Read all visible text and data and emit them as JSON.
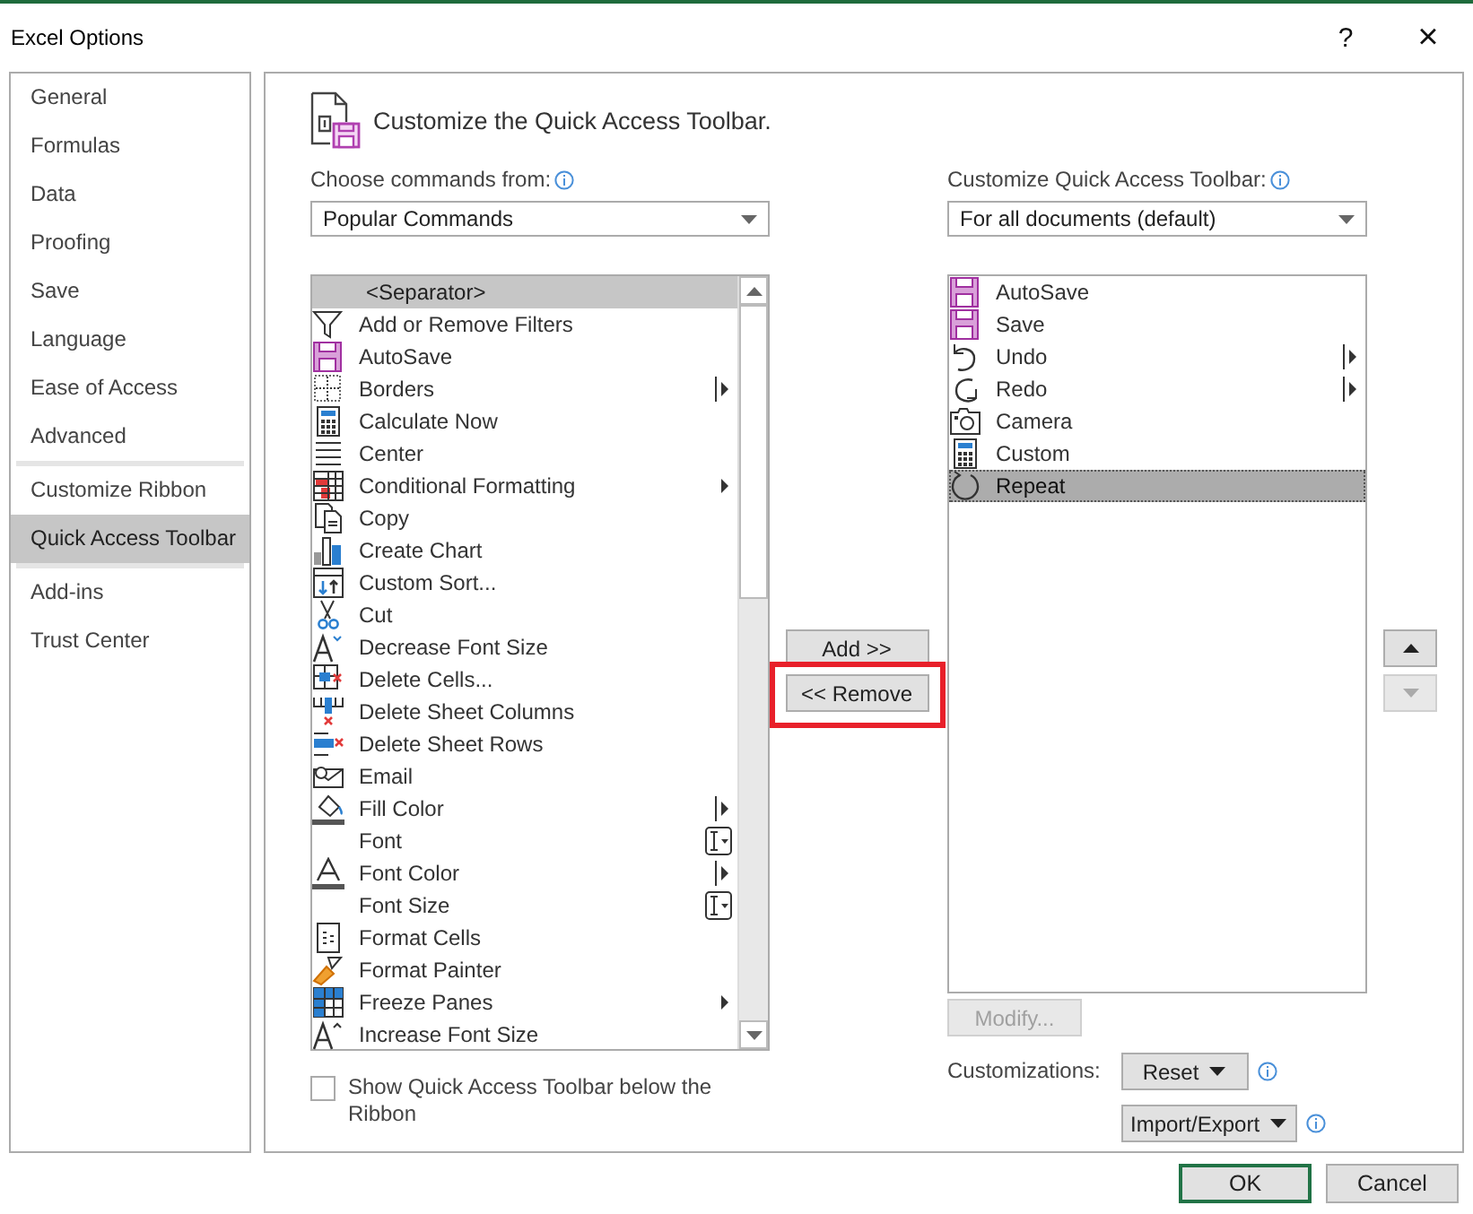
{
  "window": {
    "title": "Excel Options",
    "help": "?",
    "close": "×"
  },
  "sidebar": {
    "groups": [
      [
        {
          "label": "General",
          "selected": false
        },
        {
          "label": "Formulas",
          "selected": false
        },
        {
          "label": "Data",
          "selected": false
        },
        {
          "label": "Proofing",
          "selected": false
        },
        {
          "label": "Save",
          "selected": false
        },
        {
          "label": "Language",
          "selected": false
        },
        {
          "label": "Ease of Access",
          "selected": false
        },
        {
          "label": "Advanced",
          "selected": false
        }
      ],
      [
        {
          "label": "Customize Ribbon",
          "selected": false
        },
        {
          "label": "Quick Access Toolbar",
          "selected": true
        }
      ],
      [
        {
          "label": "Add-ins",
          "selected": false
        },
        {
          "label": "Trust Center",
          "selected": false
        }
      ]
    ]
  },
  "heading": "Customize the Quick Access Toolbar.",
  "commands": {
    "label": "Choose commands from:",
    "dropdown": "Popular Commands",
    "items": [
      {
        "label": "<Separator>",
        "selected": true,
        "kind": "separator"
      },
      {
        "label": "Add or Remove Filters",
        "selected": false,
        "kind": "plain"
      },
      {
        "label": "AutoSave",
        "selected": false,
        "kind": "plain"
      },
      {
        "label": "Borders",
        "selected": false,
        "kind": "split"
      },
      {
        "label": "Calculate Now",
        "selected": false,
        "kind": "plain"
      },
      {
        "label": "Center",
        "selected": false,
        "kind": "plain"
      },
      {
        "label": "Conditional Formatting",
        "selected": false,
        "kind": "menu"
      },
      {
        "label": "Copy",
        "selected": false,
        "kind": "plain"
      },
      {
        "label": "Create Chart",
        "selected": false,
        "kind": "plain"
      },
      {
        "label": "Custom Sort...",
        "selected": false,
        "kind": "plain"
      },
      {
        "label": "Cut",
        "selected": false,
        "kind": "plain"
      },
      {
        "label": "Decrease Font Size",
        "selected": false,
        "kind": "plain"
      },
      {
        "label": "Delete Cells...",
        "selected": false,
        "kind": "plain"
      },
      {
        "label": "Delete Sheet Columns",
        "selected": false,
        "kind": "plain"
      },
      {
        "label": "Delete Sheet Rows",
        "selected": false,
        "kind": "plain"
      },
      {
        "label": "Email",
        "selected": false,
        "kind": "plain"
      },
      {
        "label": "Fill Color",
        "selected": false,
        "kind": "split"
      },
      {
        "label": "Font",
        "selected": false,
        "kind": "combo"
      },
      {
        "label": "Font Color",
        "selected": false,
        "kind": "split"
      },
      {
        "label": "Font Size",
        "selected": false,
        "kind": "combo"
      },
      {
        "label": "Format Cells",
        "selected": false,
        "kind": "plain"
      },
      {
        "label": "Format Painter",
        "selected": false,
        "kind": "plain"
      },
      {
        "label": "Freeze Panes",
        "selected": false,
        "kind": "menu"
      },
      {
        "label": "Increase Font Size",
        "selected": false,
        "kind": "plain"
      }
    ]
  },
  "toolbar": {
    "label": "Customize Quick Access Toolbar:",
    "dropdown": "For all documents (default)",
    "items": [
      {
        "label": "AutoSave",
        "selected": false,
        "kind": "plain"
      },
      {
        "label": "Save",
        "selected": false,
        "kind": "plain"
      },
      {
        "label": "Undo",
        "selected": false,
        "kind": "split"
      },
      {
        "label": "Redo",
        "selected": false,
        "kind": "split"
      },
      {
        "label": "Camera",
        "selected": false,
        "kind": "plain"
      },
      {
        "label": "Custom",
        "selected": false,
        "kind": "plain"
      },
      {
        "label": "Repeat",
        "selected": true,
        "kind": "plain"
      }
    ]
  },
  "add_button": {
    "label": "Add >>",
    "disabled": false
  },
  "remove_button": {
    "label": "<< Remove",
    "disabled": false,
    "highlighted": true
  },
  "move_up": {
    "disabled": false
  },
  "move_down": {
    "disabled": true
  },
  "modify_button": {
    "label": "Modify...",
    "disabled": true
  },
  "customizations": {
    "label": "Customizations:",
    "reset": "Reset",
    "import_export": "Import/Export"
  },
  "below_ribbon": {
    "label": "Show Quick Access Toolbar below the Ribbon",
    "checked": false
  },
  "footer": {
    "ok": "OK",
    "cancel": "Cancel"
  }
}
